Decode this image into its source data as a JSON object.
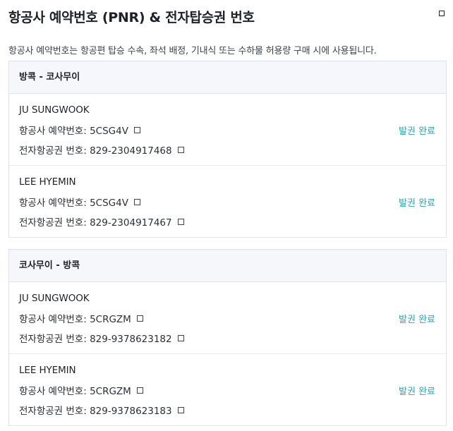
{
  "page": {
    "title": "항공사 예약번호 (PNR) & 전자탑승권 번호",
    "description": "항공사 예약번호는 항공편 탑승 수속, 좌석 배정, 기내식 또는 수하물 허용량 구매 시에 사용됩니다."
  },
  "segments": [
    {
      "route": "방콕 - 코사무이",
      "passengers": [
        {
          "name": "JU SUNGWOOK",
          "pnr_text": "항공사 예약번호: 5CSG4V",
          "ticket_text": "전자항공권 번호: 829-2304917468",
          "status": "발권 완료"
        },
        {
          "name": "LEE HYEMIN",
          "pnr_text": "항공사 예약번호: 5CSG4V",
          "ticket_text": "전자항공권 번호: 829-2304917467",
          "status": "발권 완료"
        }
      ]
    },
    {
      "route": "코사무이 - 방콕",
      "passengers": [
        {
          "name": "JU SUNGWOOK",
          "pnr_text": "항공사 예약번호: 5CRGZM",
          "ticket_text": "전자항공권 번호: 829-9378623182",
          "status": "발권 완료"
        },
        {
          "name": "LEE HYEMIN",
          "pnr_text": "항공사 예약번호: 5CRGZM",
          "ticket_text": "전자항공권 번호: 829-9378623183",
          "status": "발권 완료"
        }
      ]
    }
  ],
  "colors": {
    "accent": "#2aa6b4",
    "section_header_bg": "#f5f7fa",
    "border": "#dfe3e8"
  },
  "icons": {
    "copy": "copy-icon",
    "corner": "window-icon"
  }
}
